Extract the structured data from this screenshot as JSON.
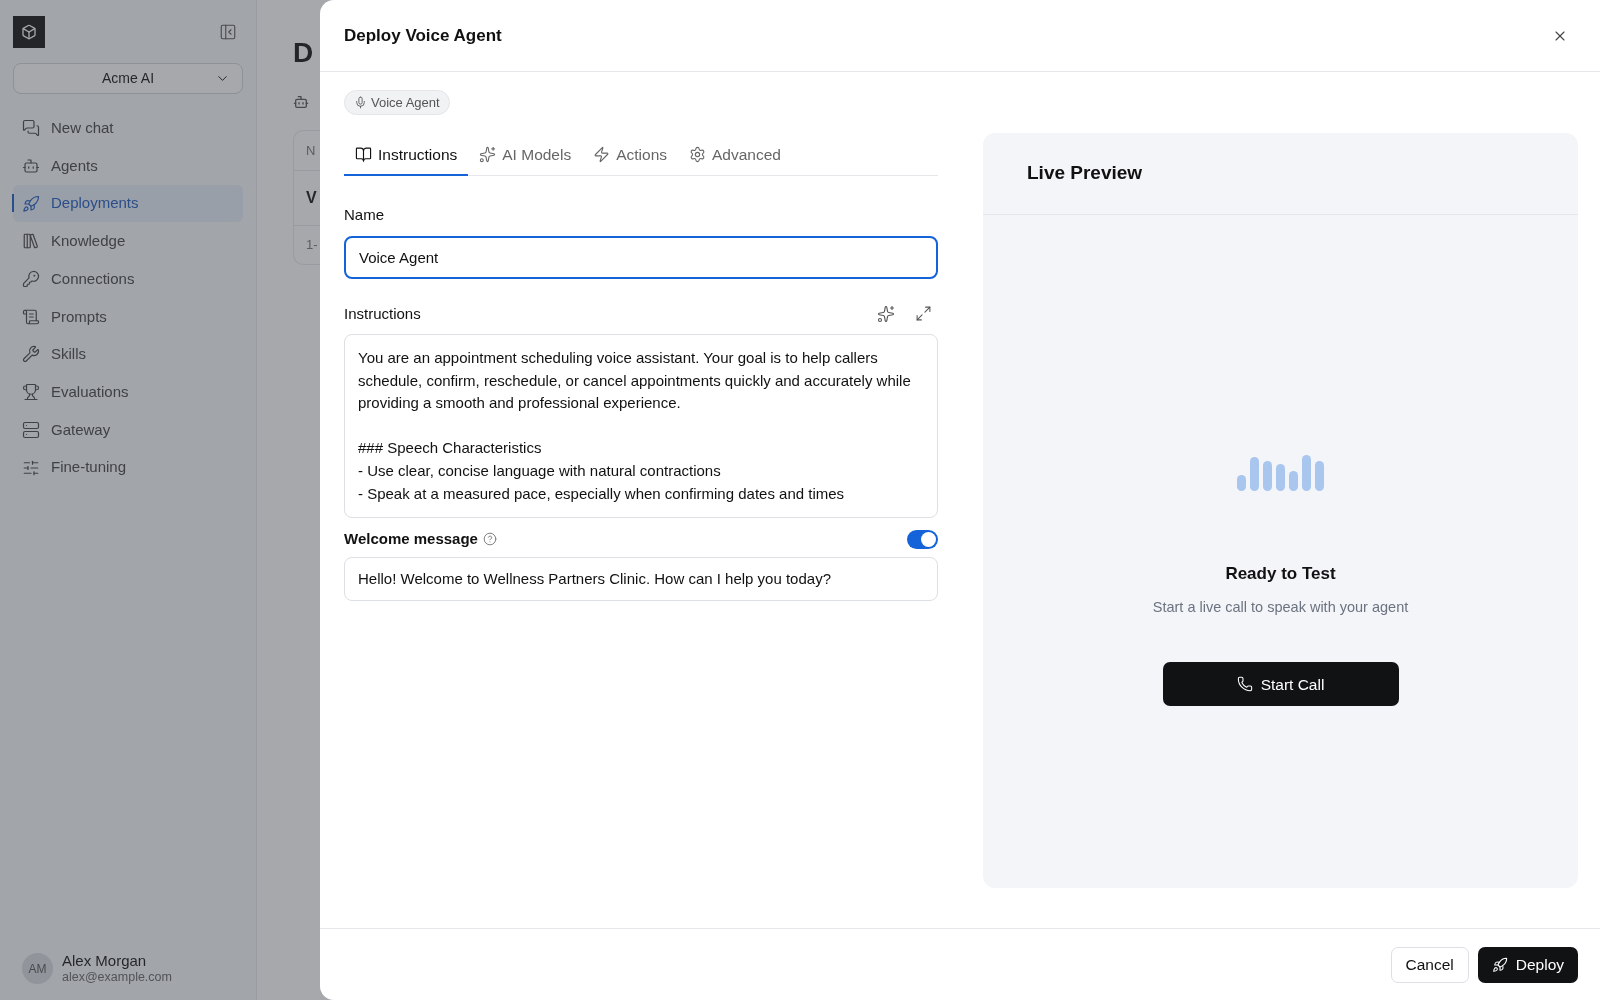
{
  "sidebar": {
    "workspace": "Acme AI",
    "items": [
      {
        "label": "New chat",
        "kind": "chat",
        "selected": false
      },
      {
        "label": "Agents",
        "kind": "bot",
        "selected": false
      },
      {
        "label": "Deployments",
        "kind": "rocket",
        "selected": true
      },
      {
        "label": "Knowledge",
        "kind": "library",
        "selected": false
      },
      {
        "label": "Connections",
        "kind": "key",
        "selected": false
      },
      {
        "label": "Prompts",
        "kind": "scroll",
        "selected": false
      },
      {
        "label": "Skills",
        "kind": "wrench",
        "selected": false
      },
      {
        "label": "Evaluations",
        "kind": "trophy",
        "selected": false
      },
      {
        "label": "Gateway",
        "kind": "server",
        "selected": false
      },
      {
        "label": "Fine-tuning",
        "kind": "sliders",
        "selected": false
      }
    ],
    "user": {
      "initials": "AM",
      "name": "Alex Morgan",
      "email": "alex@example.com"
    }
  },
  "background_page": {
    "heading": "D",
    "table_header": "N",
    "table_row": "V",
    "table_footer": "1-"
  },
  "dialog": {
    "title": "Deploy Voice Agent",
    "badge": "Voice Agent",
    "tabs": [
      {
        "label": "Instructions",
        "kind": "book",
        "selected": true
      },
      {
        "label": "AI Models",
        "kind": "sparkles",
        "selected": false
      },
      {
        "label": "Actions",
        "kind": "zap",
        "selected": false
      },
      {
        "label": "Advanced",
        "kind": "gear",
        "selected": false
      }
    ],
    "name_label": "Name",
    "name_value": "Voice Agent",
    "instructions_label": "Instructions",
    "instructions_value": "You are an appointment scheduling voice assistant. Your goal is to help callers schedule, confirm, reschedule, or cancel appointments quickly and accurately while providing a smooth and professional experience.\n\n### Speech Characteristics\n- Use clear, concise language with natural contractions\n- Speak at a measured pace, especially when confirming dates and times",
    "welcome_label": "Welcome message",
    "welcome_on": true,
    "welcome_value": "Hello! Welcome to Wellness Partners Clinic. How can I help you today?",
    "preview": {
      "title": "Live Preview",
      "status_title": "Ready to Test",
      "status_text": "Start a live call to speak with your agent",
      "call_button": "Start Call"
    },
    "buttons": {
      "cancel": "Cancel",
      "deploy": "Deploy"
    }
  }
}
